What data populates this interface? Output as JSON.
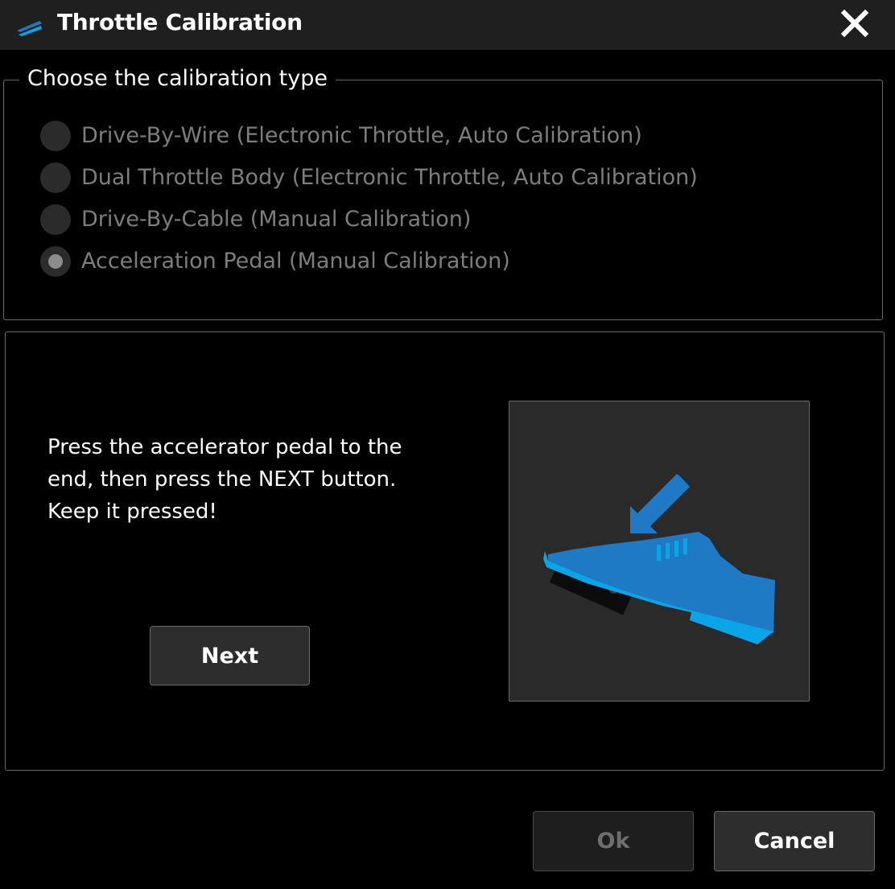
{
  "window": {
    "title": "Throttle Calibration",
    "app_icon": "speed-stripes-icon",
    "close_icon": "close-icon"
  },
  "calibration_group": {
    "legend": "Choose the calibration type",
    "options": [
      {
        "label": "Drive-By-Wire (Electronic Throttle, Auto Calibration)",
        "checked": false
      },
      {
        "label": "Dual Throttle Body (Electronic Throttle, Auto Calibration)",
        "checked": false
      },
      {
        "label": "Drive-By-Cable (Manual Calibration)",
        "checked": false
      },
      {
        "label": "Acceleration Pedal (Manual Calibration)",
        "checked": true
      }
    ]
  },
  "step_panel": {
    "instruction_lines": [
      "Press the accelerator pedal to the",
      "end, then press the NEXT button.",
      "Keep it pressed!"
    ],
    "next_label": "Next",
    "illustration_icon": "foot-pressing-pedal-icon"
  },
  "footer": {
    "ok_label": "Ok",
    "cancel_label": "Cancel"
  },
  "colors": {
    "accent_blue": "#1e7ac4",
    "light_blue": "#0aa5e8",
    "background": "#000000",
    "titlebar": "#1f1f1f"
  }
}
